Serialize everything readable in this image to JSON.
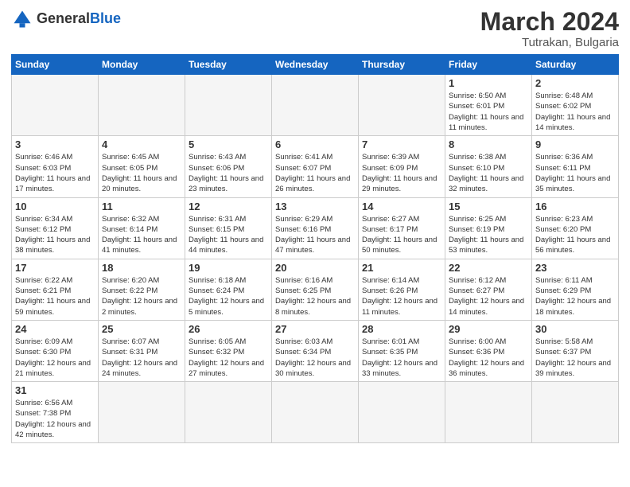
{
  "logo": {
    "general": "General",
    "blue": "Blue"
  },
  "title": {
    "month_year": "March 2024",
    "location": "Tutrakan, Bulgaria"
  },
  "weekdays": [
    "Sunday",
    "Monday",
    "Tuesday",
    "Wednesday",
    "Thursday",
    "Friday",
    "Saturday"
  ],
  "weeks": [
    [
      {
        "day": "",
        "info": ""
      },
      {
        "day": "",
        "info": ""
      },
      {
        "day": "",
        "info": ""
      },
      {
        "day": "",
        "info": ""
      },
      {
        "day": "",
        "info": ""
      },
      {
        "day": "1",
        "info": "Sunrise: 6:50 AM\nSunset: 6:01 PM\nDaylight: 11 hours\nand 11 minutes."
      },
      {
        "day": "2",
        "info": "Sunrise: 6:48 AM\nSunset: 6:02 PM\nDaylight: 11 hours\nand 14 minutes."
      }
    ],
    [
      {
        "day": "3",
        "info": "Sunrise: 6:46 AM\nSunset: 6:03 PM\nDaylight: 11 hours\nand 17 minutes."
      },
      {
        "day": "4",
        "info": "Sunrise: 6:45 AM\nSunset: 6:05 PM\nDaylight: 11 hours\nand 20 minutes."
      },
      {
        "day": "5",
        "info": "Sunrise: 6:43 AM\nSunset: 6:06 PM\nDaylight: 11 hours\nand 23 minutes."
      },
      {
        "day": "6",
        "info": "Sunrise: 6:41 AM\nSunset: 6:07 PM\nDaylight: 11 hours\nand 26 minutes."
      },
      {
        "day": "7",
        "info": "Sunrise: 6:39 AM\nSunset: 6:09 PM\nDaylight: 11 hours\nand 29 minutes."
      },
      {
        "day": "8",
        "info": "Sunrise: 6:38 AM\nSunset: 6:10 PM\nDaylight: 11 hours\nand 32 minutes."
      },
      {
        "day": "9",
        "info": "Sunrise: 6:36 AM\nSunset: 6:11 PM\nDaylight: 11 hours\nand 35 minutes."
      }
    ],
    [
      {
        "day": "10",
        "info": "Sunrise: 6:34 AM\nSunset: 6:12 PM\nDaylight: 11 hours\nand 38 minutes."
      },
      {
        "day": "11",
        "info": "Sunrise: 6:32 AM\nSunset: 6:14 PM\nDaylight: 11 hours\nand 41 minutes."
      },
      {
        "day": "12",
        "info": "Sunrise: 6:31 AM\nSunset: 6:15 PM\nDaylight: 11 hours\nand 44 minutes."
      },
      {
        "day": "13",
        "info": "Sunrise: 6:29 AM\nSunset: 6:16 PM\nDaylight: 11 hours\nand 47 minutes."
      },
      {
        "day": "14",
        "info": "Sunrise: 6:27 AM\nSunset: 6:17 PM\nDaylight: 11 hours\nand 50 minutes."
      },
      {
        "day": "15",
        "info": "Sunrise: 6:25 AM\nSunset: 6:19 PM\nDaylight: 11 hours\nand 53 minutes."
      },
      {
        "day": "16",
        "info": "Sunrise: 6:23 AM\nSunset: 6:20 PM\nDaylight: 11 hours\nand 56 minutes."
      }
    ],
    [
      {
        "day": "17",
        "info": "Sunrise: 6:22 AM\nSunset: 6:21 PM\nDaylight: 11 hours\nand 59 minutes."
      },
      {
        "day": "18",
        "info": "Sunrise: 6:20 AM\nSunset: 6:22 PM\nDaylight: 12 hours\nand 2 minutes."
      },
      {
        "day": "19",
        "info": "Sunrise: 6:18 AM\nSunset: 6:24 PM\nDaylight: 12 hours\nand 5 minutes."
      },
      {
        "day": "20",
        "info": "Sunrise: 6:16 AM\nSunset: 6:25 PM\nDaylight: 12 hours\nand 8 minutes."
      },
      {
        "day": "21",
        "info": "Sunrise: 6:14 AM\nSunset: 6:26 PM\nDaylight: 12 hours\nand 11 minutes."
      },
      {
        "day": "22",
        "info": "Sunrise: 6:12 AM\nSunset: 6:27 PM\nDaylight: 12 hours\nand 14 minutes."
      },
      {
        "day": "23",
        "info": "Sunrise: 6:11 AM\nSunset: 6:29 PM\nDaylight: 12 hours\nand 18 minutes."
      }
    ],
    [
      {
        "day": "24",
        "info": "Sunrise: 6:09 AM\nSunset: 6:30 PM\nDaylight: 12 hours\nand 21 minutes."
      },
      {
        "day": "25",
        "info": "Sunrise: 6:07 AM\nSunset: 6:31 PM\nDaylight: 12 hours\nand 24 minutes."
      },
      {
        "day": "26",
        "info": "Sunrise: 6:05 AM\nSunset: 6:32 PM\nDaylight: 12 hours\nand 27 minutes."
      },
      {
        "day": "27",
        "info": "Sunrise: 6:03 AM\nSunset: 6:34 PM\nDaylight: 12 hours\nand 30 minutes."
      },
      {
        "day": "28",
        "info": "Sunrise: 6:01 AM\nSunset: 6:35 PM\nDaylight: 12 hours\nand 33 minutes."
      },
      {
        "day": "29",
        "info": "Sunrise: 6:00 AM\nSunset: 6:36 PM\nDaylight: 12 hours\nand 36 minutes."
      },
      {
        "day": "30",
        "info": "Sunrise: 5:58 AM\nSunset: 6:37 PM\nDaylight: 12 hours\nand 39 minutes."
      }
    ],
    [
      {
        "day": "31",
        "info": "Sunrise: 6:56 AM\nSunset: 7:38 PM\nDaylight: 12 hours\nand 42 minutes."
      },
      {
        "day": "",
        "info": ""
      },
      {
        "day": "",
        "info": ""
      },
      {
        "day": "",
        "info": ""
      },
      {
        "day": "",
        "info": ""
      },
      {
        "day": "",
        "info": ""
      },
      {
        "day": "",
        "info": ""
      }
    ]
  ]
}
